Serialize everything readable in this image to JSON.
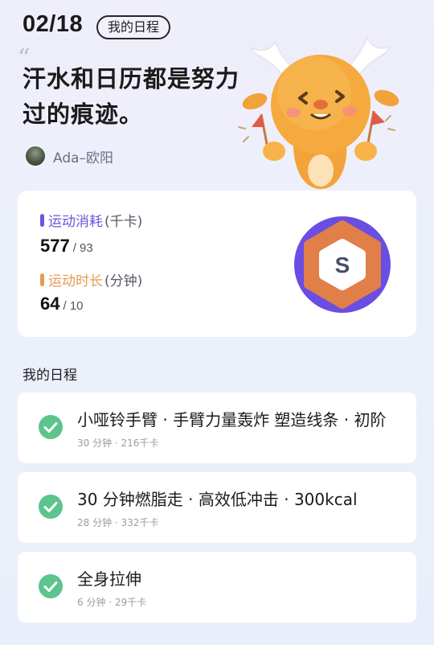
{
  "header": {
    "date": "02/18",
    "schedule_tag": "我的日程",
    "quote_mark": "“",
    "quote": "汗水和日历都是努力过的痕迹。",
    "author": "Ada–欧阳"
  },
  "stats": {
    "calories": {
      "label": "运动消耗",
      "unit": "(千卡)",
      "value": "577",
      "goal": "/ 93",
      "color": "#6a55e0"
    },
    "duration": {
      "label": "运动时长",
      "unit": "(分钟)",
      "value": "64",
      "goal": "/ 10",
      "color": "#e79a55"
    },
    "badge_letter": "S",
    "badge_colors": {
      "outer": "#6a4de3",
      "ring": "#e07f48",
      "inner": "#ffffff",
      "letter": "#4b4f66"
    }
  },
  "schedule": {
    "title": "我的日程",
    "items": [
      {
        "title": "小哑铃手臂 · 手臂力量轰炸 塑造线条 · 初阶",
        "meta": "30 分钟 · 216千卡"
      },
      {
        "title": "30 分钟燃脂走 · 高效低冲击 · 300kcal",
        "meta": "28 分钟 · 332千卡"
      },
      {
        "title": "全身拉伸",
        "meta": "6 分钟 · 29千卡"
      }
    ],
    "check_color": "#5cc48d"
  }
}
